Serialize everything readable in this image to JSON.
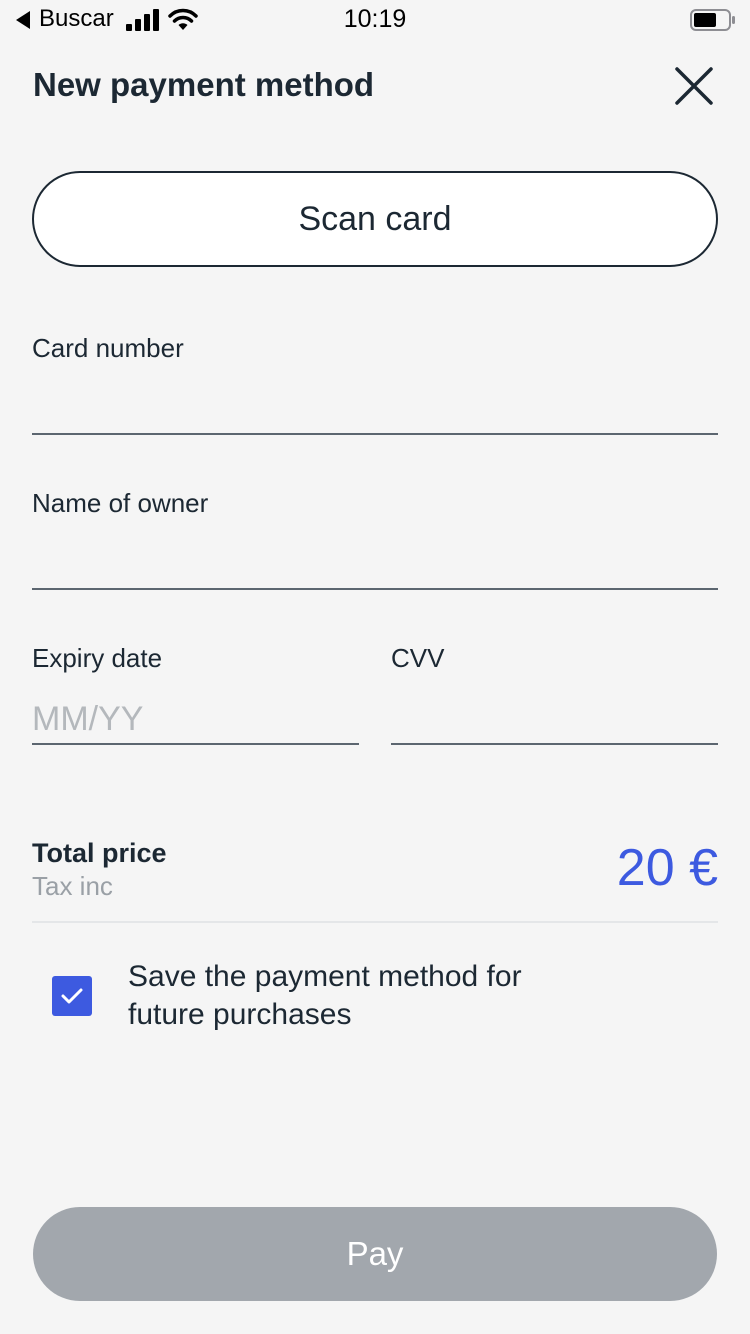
{
  "status_bar": {
    "back_label": "Buscar",
    "time": "10:19"
  },
  "header": {
    "title": "New payment method",
    "close_icon": "close-icon"
  },
  "scan_card_label": "Scan card",
  "fields": {
    "card_number": {
      "label": "Card number",
      "value": "",
      "placeholder": ""
    },
    "owner_name": {
      "label": "Name of owner",
      "value": "",
      "placeholder": ""
    },
    "expiry": {
      "label": "Expiry date",
      "value": "",
      "placeholder": "MM/YY"
    },
    "cvv": {
      "label": "CVV",
      "value": "",
      "placeholder": ""
    }
  },
  "total": {
    "label": "Total price",
    "sublabel": "Tax inc",
    "value": "20 €"
  },
  "save_method": {
    "checked": true,
    "label": "Save the payment method for future purchases"
  },
  "pay_label": "Pay",
  "colors": {
    "accent": "#3d5ae0",
    "text": "#1c2833",
    "pay_disabled": "#a2a7ad",
    "background": "#f5f5f5"
  }
}
